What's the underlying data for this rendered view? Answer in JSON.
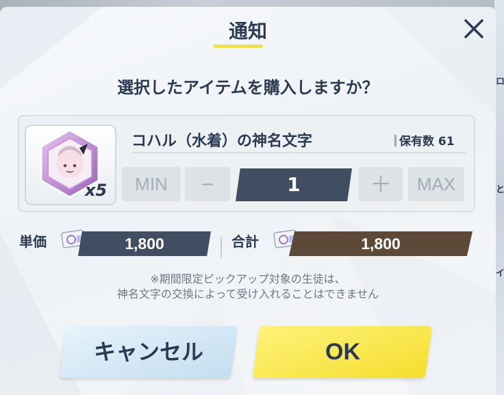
{
  "dialog": {
    "title": "通知",
    "question": "選択したアイテムを購入しますか？"
  },
  "item": {
    "name": "コハル（水着）の神名文字",
    "count_badge": "x5",
    "owned_label": "保有数",
    "owned_value": "61"
  },
  "quantity": {
    "min_label": "MIN",
    "minus_label": "−",
    "value": "1",
    "plus_label": "＋",
    "max_label": "MAX"
  },
  "price": {
    "unit_label": "単価",
    "unit_value": "1,800",
    "total_label": "合計",
    "total_value": "1,800"
  },
  "notice": {
    "line1": "※期間限定ピックアップ対象の生徒は、",
    "line2": "神名文字の交換によって受け入れることはできません"
  },
  "buttons": {
    "cancel": "キャンセル",
    "ok": "OK"
  },
  "background": {
    "right_label_1": "ロ",
    "right_label_2": "と",
    "right_label_3": "イ"
  },
  "colors": {
    "navy": "#414e62",
    "brown": "#5d4938",
    "accent_yellow": "#f5e32f",
    "text": "#2b3a52"
  }
}
